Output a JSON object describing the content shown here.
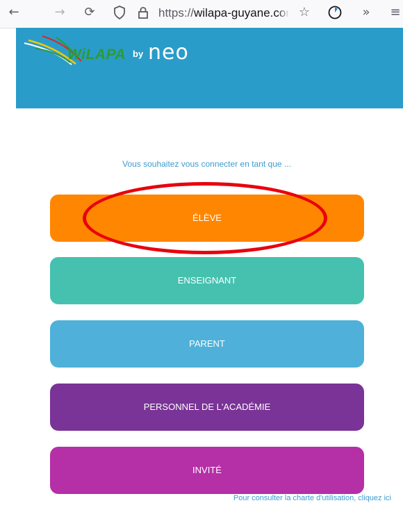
{
  "browser": {
    "url_prefix": "https://",
    "url_domain": "wilapa-guyane.com/",
    "icons": [
      "back-icon",
      "forward-icon",
      "reload-icon",
      "shield-icon",
      "lock-icon",
      "star-icon",
      "extension-timer-icon",
      "overflow-icon",
      "menu-icon"
    ]
  },
  "header": {
    "logo_text": "WiLAPA",
    "logo_by": "by",
    "logo_brand": "neo"
  },
  "main": {
    "prompt": "Vous souhaitez vous connecter en tant que ...",
    "roles": [
      {
        "label": "ÉLÈVE",
        "color": "#ff8600"
      },
      {
        "label": "ENSEIGNANT",
        "color": "#46c1b0"
      },
      {
        "label": "PARENT",
        "color": "#4fb1d9"
      },
      {
        "label": "PERSONNEL DE L'ACADÉMIE",
        "color": "#7a3396"
      },
      {
        "label": "INVITÉ",
        "color": "#b52fa7"
      }
    ],
    "footer_link": "Pour consulter la charte d'utilisation, cliquez ici"
  },
  "annotation": {
    "color": "#e8000d",
    "target": "ÉLÈVE"
  }
}
